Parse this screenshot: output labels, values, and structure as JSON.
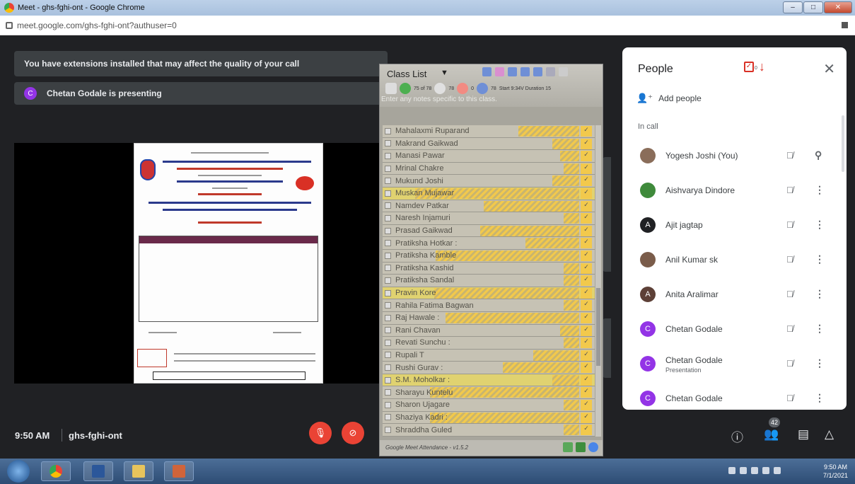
{
  "window": {
    "title": "Meet - ghs-fghi-ont - Google Chrome",
    "url": "meet.google.com/ghs-fghi-ont?authuser=0"
  },
  "meet": {
    "extensions_warning": "You have extensions installed that may affect the quality of your call",
    "presenter_initial": "C",
    "presenting_text": "Chetan Godale is presenting"
  },
  "class_list": {
    "title": "Class List",
    "notes_placeholder": "Enter any notes specific to this class.",
    "stats": [
      "75 of 78",
      "78",
      "0",
      "78"
    ],
    "start_label": "Start 9:34V Duration 15",
    "version": "Google Meet Attendance - v1.5.2",
    "students": [
      {
        "name": "Mahalaxmi Ruparand",
        "bar": 0.32,
        "hl": false
      },
      {
        "name": "Makrand Gaikwad",
        "bar": 0.14,
        "hl": false
      },
      {
        "name": "Manasi Pawar",
        "bar": 0.1,
        "hl": false
      },
      {
        "name": "Mrinal Chakre",
        "bar": 0.08,
        "hl": false
      },
      {
        "name": "Mukund Joshi",
        "bar": 0.14,
        "hl": false
      },
      {
        "name": "Muskan Mujawar",
        "bar": 0.86,
        "hl": true
      },
      {
        "name": "Namdev Patkar",
        "bar": 0.5,
        "hl": false
      },
      {
        "name": "Naresh Injamuri",
        "bar": 0.08,
        "hl": false
      },
      {
        "name": "Prasad Gaikwad",
        "bar": 0.52,
        "hl": false
      },
      {
        "name": "Pratiksha Hotkar :",
        "bar": 0.28,
        "hl": false
      },
      {
        "name": "Pratiksha Kamble",
        "bar": 0.75,
        "hl": false
      },
      {
        "name": "Pratiksha Kashid",
        "bar": 0.08,
        "hl": false
      },
      {
        "name": "Pratiksha Sandal",
        "bar": 0.08,
        "hl": false
      },
      {
        "name": "Pravin Kore",
        "bar": 0.76,
        "hl": true
      },
      {
        "name": "Rahila Fatima Bagwan",
        "bar": 0.08,
        "hl": false
      },
      {
        "name": "Raj Hawale :",
        "bar": 0.7,
        "hl": false
      },
      {
        "name": "Rani Chavan",
        "bar": 0.1,
        "hl": false
      },
      {
        "name": "Revati Sunchu :",
        "bar": 0.08,
        "hl": false
      },
      {
        "name": "Rupali T",
        "bar": 0.24,
        "hl": false
      },
      {
        "name": "Rushi Gurav :",
        "bar": 0.4,
        "hl": false
      },
      {
        "name": "S.M. Moholkar :",
        "bar": 0.14,
        "hl": true
      },
      {
        "name": "Sharayu Kuntelu",
        "bar": 0.78,
        "hl": false
      },
      {
        "name": "Sharon Ujagare",
        "bar": 0.08,
        "hl": false
      },
      {
        "name": "Shaziya Kadri :",
        "bar": 0.78,
        "hl": false
      },
      {
        "name": "Shraddha Guled",
        "bar": 0.08,
        "hl": false
      }
    ]
  },
  "people": {
    "title": "People",
    "attendance_count": "0",
    "add_people": "Add people",
    "in_call": "In call",
    "participants": [
      {
        "name": "Yogesh Joshi (You)",
        "sub": "",
        "initial": "",
        "color": "#8a6d5a",
        "action": "pin"
      },
      {
        "name": "Aishvarya Dindore",
        "sub": "",
        "initial": "",
        "color": "#3f8a3b",
        "action": "more"
      },
      {
        "name": "Ajit jagtap",
        "sub": "",
        "initial": "A",
        "color": "#202124",
        "action": "more"
      },
      {
        "name": "Anil Kumar sk",
        "sub": "",
        "initial": "",
        "color": "#7a5c4a",
        "action": "more"
      },
      {
        "name": "Anita Aralimar",
        "sub": "",
        "initial": "A",
        "color": "#5d4037",
        "action": "more"
      },
      {
        "name": "Chetan Godale",
        "sub": "",
        "initial": "C",
        "color": "#9334e6",
        "action": "more"
      },
      {
        "name": "Chetan Godale",
        "sub": "Presentation",
        "initial": "C",
        "color": "#9334e6",
        "action": "more"
      },
      {
        "name": "Chetan Godale",
        "sub": "",
        "initial": "C",
        "color": "#9334e6",
        "action": "more"
      }
    ]
  },
  "bottom": {
    "time": "9:50 AM",
    "meeting_code": "ghs-fghi-ont",
    "participant_count": "42"
  },
  "taskbar": {
    "time": "9:50 AM",
    "date": "7/1/2021"
  }
}
